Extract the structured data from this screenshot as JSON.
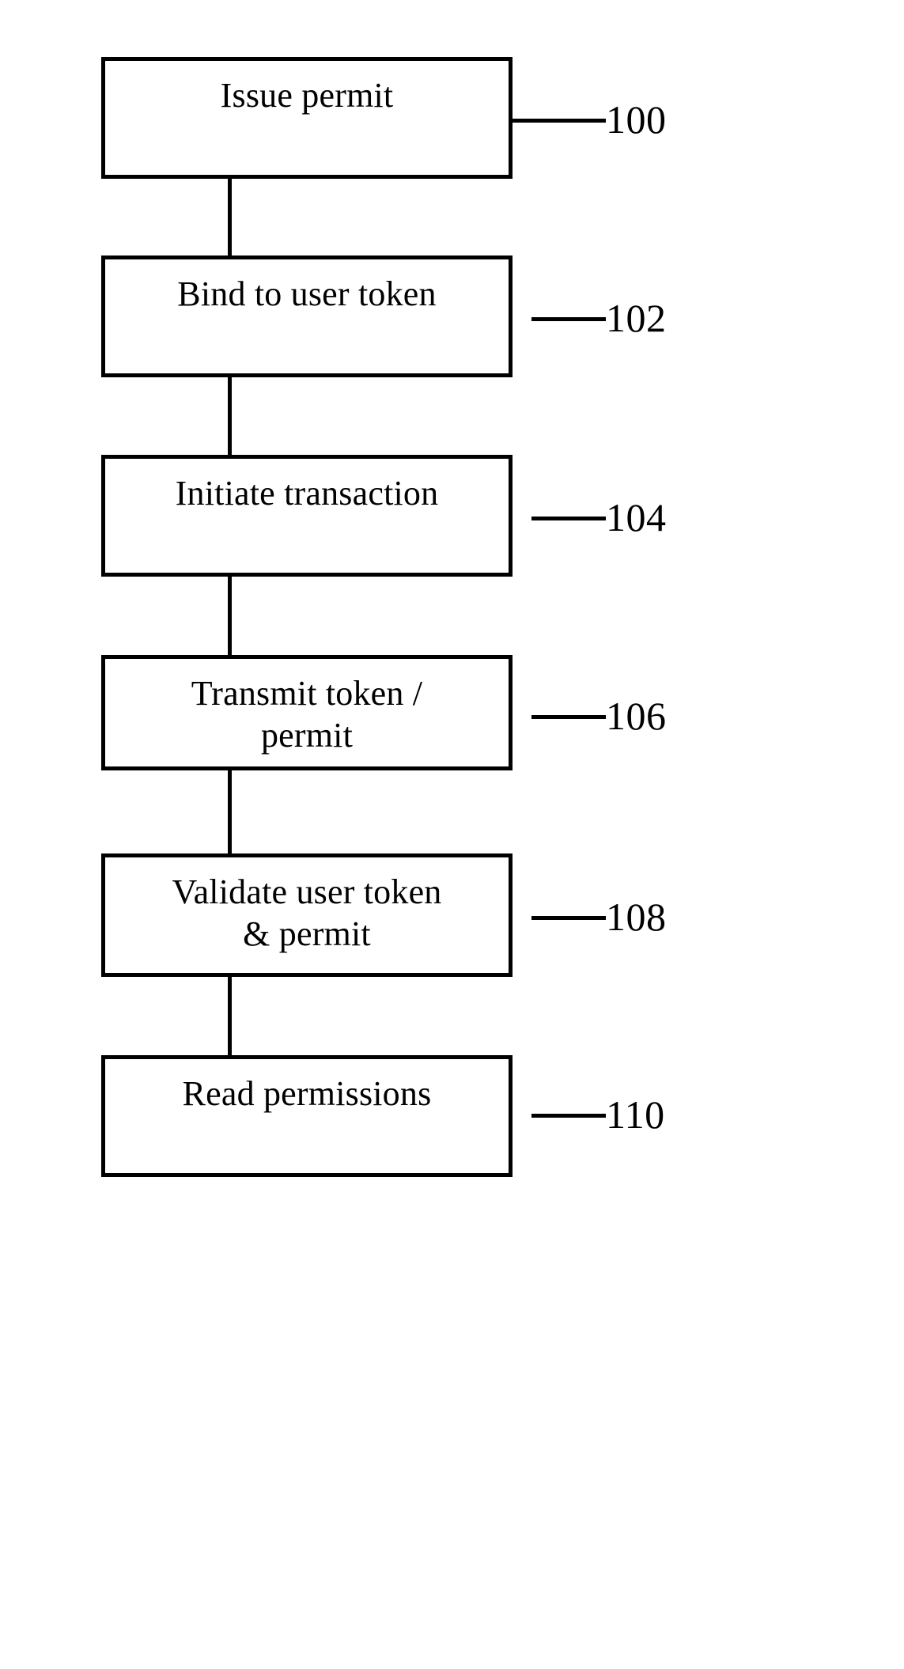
{
  "diagram": {
    "type": "flowchart",
    "orientation": "vertical",
    "style": "patent-figure",
    "colors": {
      "stroke": "#000000",
      "background": "#ffffff",
      "text": "#000000"
    },
    "steps": [
      {
        "id": "step-0",
        "label": "Issue permit",
        "ref": "100"
      },
      {
        "id": "step-1",
        "label": "Bind to user token",
        "ref": "102"
      },
      {
        "id": "step-2",
        "label": "Initiate transaction",
        "ref": "104"
      },
      {
        "id": "step-3",
        "label": "Transmit token /\npermit",
        "ref": "106"
      },
      {
        "id": "step-4",
        "label": "Validate user token\n& permit",
        "ref": "108"
      },
      {
        "id": "step-5",
        "label": "Read permissions",
        "ref": "110"
      }
    ],
    "connectors": [
      {
        "from": "step-0",
        "to": "step-1"
      },
      {
        "from": "step-1",
        "to": "step-2"
      },
      {
        "from": "step-2",
        "to": "step-3"
      },
      {
        "from": "step-3",
        "to": "step-4"
      },
      {
        "from": "step-4",
        "to": "step-5"
      }
    ]
  }
}
